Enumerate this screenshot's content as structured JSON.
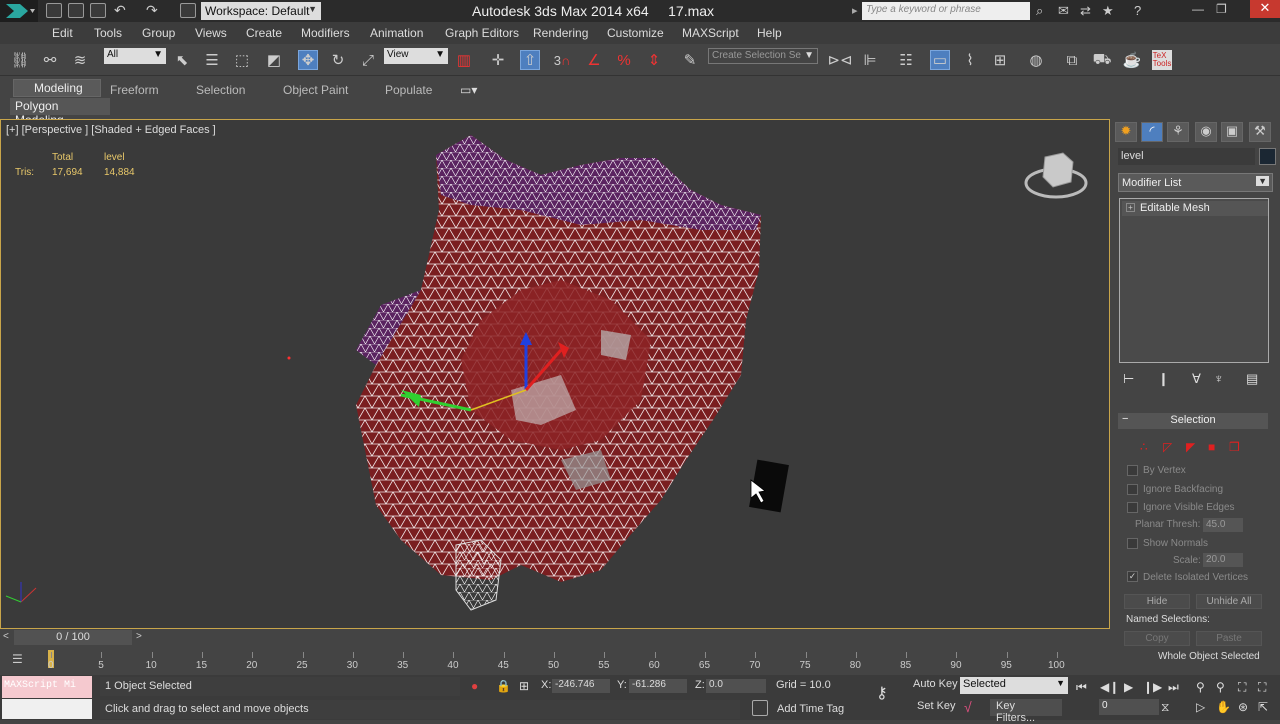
{
  "app": {
    "title": "Autodesk 3ds Max  2014 x64",
    "file": "17.max",
    "workspace": "Workspace: Default",
    "search_placeholder": "Type a keyword or phrase"
  },
  "menu": [
    "Edit",
    "Tools",
    "Group",
    "Views",
    "Create",
    "Modifiers",
    "Animation",
    "Graph Editors",
    "Rendering",
    "Customize",
    "MAXScript",
    "Help"
  ],
  "toolbar": {
    "filter": "All",
    "refcoord": "View",
    "named_sel": "Create Selection Se",
    "snap_label": "3"
  },
  "ribbon": {
    "tabs": [
      "Modeling",
      "Freeform",
      "Selection",
      "Object Paint",
      "Populate"
    ],
    "panel": "Polygon Modeling"
  },
  "viewport": {
    "label": "[+] [Perspective ] [Shaded + Edged Faces ]",
    "stats": {
      "col_total": "Total",
      "col_level": "level",
      "row_label": "Tris:",
      "total": "17,694",
      "level": "14,884"
    }
  },
  "command_panel": {
    "object_name": "level",
    "modifier_list": "Modifier List",
    "stack_item": "Editable Mesh",
    "selection": {
      "title": "Selection",
      "by_vertex": "By Vertex",
      "ignore_backfacing": "Ignore Backfacing",
      "ignore_visible_edges": "Ignore Visible Edges",
      "planar_thresh_label": "Planar Thresh:",
      "planar_thresh": "45.0",
      "show_normals": "Show Normals",
      "scale_label": "Scale:",
      "scale": "20.0",
      "delete_isolated": "Delete Isolated Vertices",
      "hide": "Hide",
      "unhide_all": "Unhide All",
      "named_selections": "Named Selections:",
      "copy": "Copy",
      "paste": "Paste",
      "whole_object": "Whole Object Selected"
    }
  },
  "timeline": {
    "slider": "0 / 100",
    "ticks": [
      "0",
      "5",
      "10",
      "15",
      "20",
      "25",
      "30",
      "35",
      "40",
      "45",
      "50",
      "55",
      "60",
      "65",
      "70",
      "75",
      "80",
      "85",
      "90",
      "95",
      "100"
    ]
  },
  "status": {
    "maxscript": "MAXScript Mi",
    "selected": "1 Object Selected",
    "prompt": "Click and drag to select and move objects",
    "x_label": "X:",
    "x": "-246.746",
    "y_label": "Y:",
    "y": "-61.286",
    "z_label": "Z:",
    "z": "0.0",
    "grid": "Grid = 10.0",
    "add_time_tag": "Add Time Tag",
    "auto_key": "Auto Key",
    "set_key": "Set Key",
    "key_mode": "Selected",
    "key_filters": "Key Filters...",
    "frame": "0"
  }
}
